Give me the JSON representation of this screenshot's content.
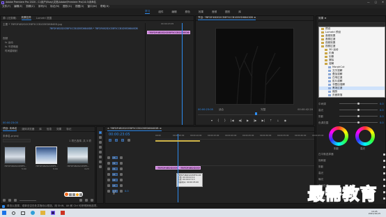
{
  "titlebar": {
    "title": "Adobe Premiere Pro 2020 - C:\\用户\\Ebay\\文档\\Adobe\\Premiere Pro\\14.0\\未命名"
  },
  "menubar": [
    "文件(F)",
    "编辑(E)",
    "剪辑(C)",
    "序列(S)",
    "标记(M)",
    "图形(G)",
    "视图(V)",
    "窗口(W)",
    "帮助(H)"
  ],
  "workspaces": [
    "学习",
    "组件",
    "编辑",
    "颜色",
    "效果",
    "音频",
    "图形",
    "库"
  ],
  "source_panel": {
    "tabs": [
      "源: (无剪辑)",
      "效果控件",
      "Lumetri 范围"
    ],
    "active_tab": "效果控件",
    "header": "主要 * 7BFDF4B2D2CE8F5CCB1D5ED6840D.jpg",
    "header2": "7BFDF4B2D2CE8F5CCB1D5ED6840DB * 7BFDF4B2D2CE8F5CCB1D5ED6840DB",
    "items": [
      "视频",
      "fx 运动",
      "fx 不透明度",
      "时间重映射"
    ],
    "timecode_left": "00:00:23:05",
    "time_ruler": "00:00:23:05",
    "clip_label": "7BFDF4B2D2CE8F5CCB1D5ED6840DB"
  },
  "program_monitor": {
    "title": "节目: 7BFDF4B2D2CE8F5CCB1D5ED6840DB ≡",
    "timecode": "00:00:23:05",
    "fit": "适合",
    "quality": "完整",
    "duration": "00:00:42:20"
  },
  "project_panel": {
    "tabs": [
      "项目: 未命名",
      "媒体浏览器",
      "库",
      "信息",
      "效果",
      "标记"
    ],
    "active_tab": "项目: 未命名",
    "file": "未命名.prproj",
    "item_count": "1 项已选择, 共 3 项",
    "thumbs": [
      {
        "name": "7BFDF4B2D2CE8F5...",
        "dur": "5:00"
      },
      {
        "name": "7BFDF4B2D2CE8F5...",
        "dur": "5:00"
      },
      {
        "name": "7BFDF4B2D2CE8F5...",
        "dur": "4:23"
      }
    ]
  },
  "timeline": {
    "tab": "× 7BFDF4B2D2CE8F5CCB1D5ED6840DB ≡",
    "timecode": "00:00:23:05",
    "ruler": [
      "00:00",
      "00:00:05:00",
      "00:00:10:00",
      "00:00:15:00",
      "00:00:20:00",
      "00:00:25:00",
      "00:00:30:00",
      "00:00:35:00",
      "00:00:40:00",
      "00:00:45:00"
    ],
    "tracks": [
      "V3",
      "V2",
      "V1",
      "A1",
      "A2",
      "A3",
      "主声道"
    ],
    "master_value": "0.0",
    "clip1": "7BFDF4B2D2CE8F5CCB1",
    "clip2": "7BFDF4B2D2CE8F5CCB1D",
    "tooltip": [
      "7BFDF4B2D2CE8F5CCB1D5ED6840DB",
      "开始: 00:00:22:14",
      "结束: 00:00:27:13",
      "持续时间: 00:00:05:00"
    ]
  },
  "effects_panel": {
    "header": "效果 ≡",
    "tree": [
      "预设",
      "Lumetri 预设",
      "音频效果",
      "音频过渡",
      "视频效果",
      "视频过渡",
      "3D 运动",
      "内滑",
      "划像",
      "擦除",
      "溶解",
      "MorphCut",
      "交叉溶解",
      "叠加溶解",
      "白场过渡",
      "胶片溶解",
      "非叠加溶解",
      "黑场过渡",
      "缩放",
      "页面剥落"
    ],
    "selected": "黑场过渡"
  },
  "lumetri": {
    "labels": [
      "中间调",
      "高光",
      "阴影",
      "色调范围",
      "白平衡选择器",
      "饱和度",
      "阴影",
      "高光",
      "曝光",
      "自动色调",
      "中间调细节",
      "亮度色调范围"
    ],
    "wheel_labels": [
      "阴影",
      "高光"
    ],
    "values": [
      "0.0",
      "0.0",
      "0.0",
      "0.0"
    ]
  },
  "status_bar": {
    "text": "单击以选择，或单击空白处并拖动以框选。用 Shift、Alt 和 Ctrl 可获得其他选项。"
  },
  "taskbar": {
    "time": "19:05",
    "date": "2021/10/15"
  },
  "watermark": "最需教育",
  "colors": {
    "accent": "#2e8cf0",
    "clip": "#c77ed6",
    "playhead": "#2e8cf0"
  }
}
